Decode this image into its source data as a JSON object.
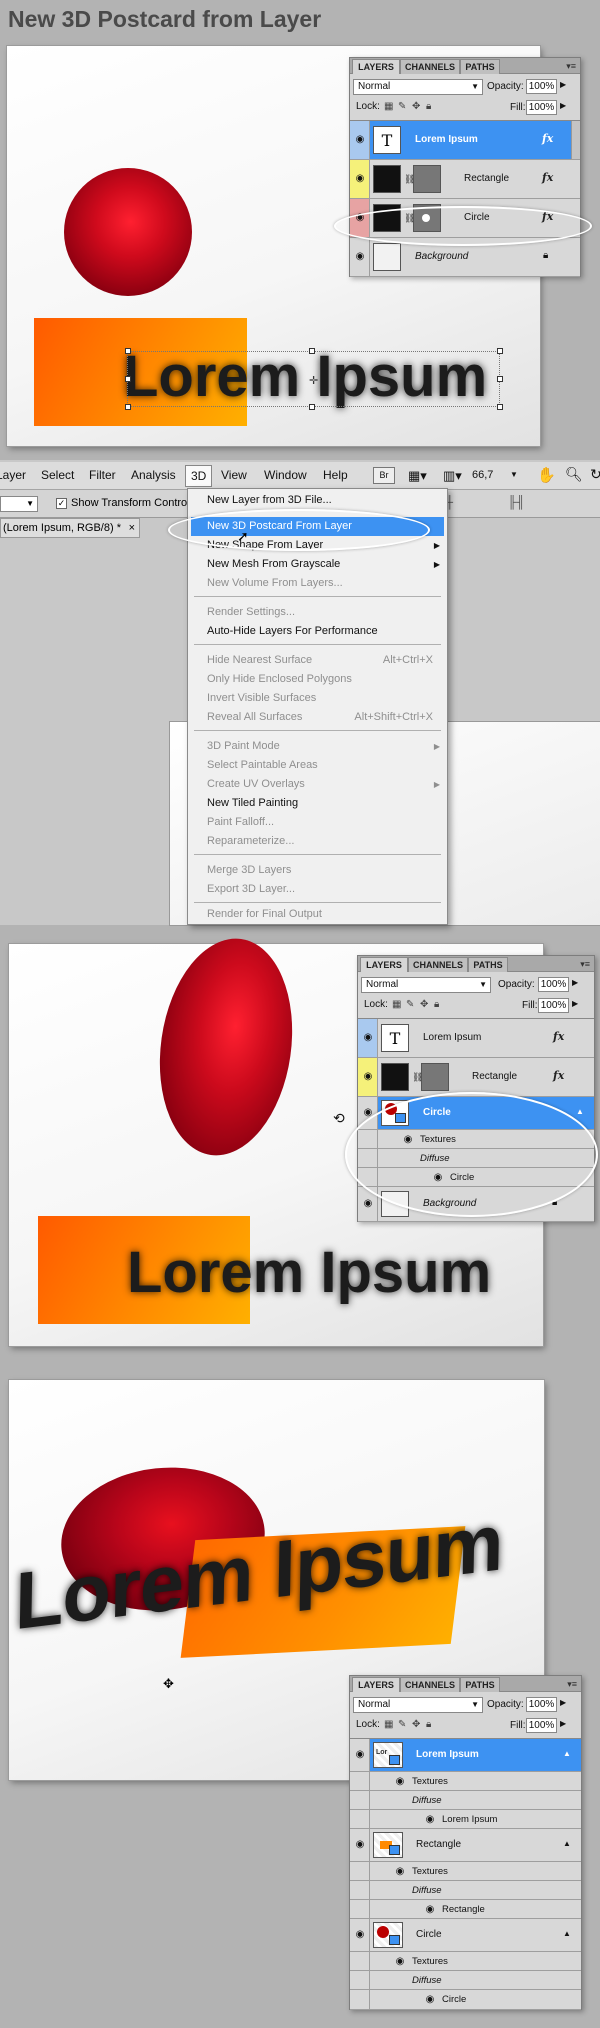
{
  "title": "New 3D Postcard from Layer",
  "canvas_text": "Lorem Ipsum",
  "panels": {
    "tabs": [
      "LAYERS",
      "CHANNELS",
      "PATHS"
    ],
    "blend_mode": "Normal",
    "opacity_label": "Opacity:",
    "opacity": "100%",
    "lock_label": "Lock:",
    "fill_label": "Fill:",
    "fill": "100%",
    "fx": "fx"
  },
  "panel1": {
    "layers": [
      {
        "name": "Lorem Ipsum",
        "thumb": "T"
      },
      {
        "name": "Rectangle"
      },
      {
        "name": "Circle"
      },
      {
        "name": "Background"
      }
    ]
  },
  "menu": {
    "bar": [
      "Layer",
      "Select",
      "Filter",
      "Analysis",
      "3D",
      "View",
      "Window",
      "Help"
    ],
    "zoom": "66,7",
    "show_transform_controls": "Show Transform Controls",
    "doc_tab": "(Lorem Ipsum, RGB/8) *",
    "items": [
      {
        "label": "New Layer from 3D File...",
        "type": "normal"
      },
      {
        "label": "New 3D Postcard From Layer",
        "type": "highlight"
      },
      {
        "label": "New Shape From Layer",
        "type": "normal",
        "submenu": true
      },
      {
        "label": "New Mesh From Grayscale",
        "type": "normal",
        "submenu": true
      },
      {
        "label": "New Volume From Layers...",
        "type": "disabled"
      },
      {
        "label": "Render Settings...",
        "type": "disabled"
      },
      {
        "label": "Auto-Hide Layers For Performance",
        "type": "normal"
      },
      {
        "label": "Hide Nearest Surface",
        "type": "disabled",
        "shortcut": "Alt+Ctrl+X"
      },
      {
        "label": "Only Hide Enclosed Polygons",
        "type": "disabled"
      },
      {
        "label": "Invert Visible Surfaces",
        "type": "disabled"
      },
      {
        "label": "Reveal All Surfaces",
        "type": "disabled",
        "shortcut": "Alt+Shift+Ctrl+X"
      },
      {
        "label": "3D Paint Mode",
        "type": "disabled",
        "submenu": true
      },
      {
        "label": "Select Paintable Areas",
        "type": "disabled"
      },
      {
        "label": "Create UV Overlays",
        "type": "disabled",
        "submenu": true
      },
      {
        "label": "New Tiled Painting",
        "type": "normal"
      },
      {
        "label": "Paint Falloff...",
        "type": "disabled"
      },
      {
        "label": "Reparameterize...",
        "type": "disabled"
      },
      {
        "label": "Merge 3D Layers",
        "type": "disabled"
      },
      {
        "label": "Export 3D Layer...",
        "type": "disabled"
      },
      {
        "label": "Render for Final Output",
        "type": "disabled"
      }
    ]
  },
  "panel3": {
    "layers": [
      {
        "name": "Lorem Ipsum",
        "thumb": "T"
      },
      {
        "name": "Rectangle"
      },
      {
        "name": "Circle"
      },
      {
        "name": "Background"
      }
    ],
    "sub": [
      "Textures",
      "Diffuse",
      "Circle"
    ]
  },
  "panel4": {
    "groups": [
      {
        "name": "Lorem Ipsum",
        "sub": [
          "Textures",
          "Diffuse",
          "Lorem Ipsum"
        ]
      },
      {
        "name": "Rectangle",
        "sub": [
          "Textures",
          "Diffuse",
          "Rectangle"
        ]
      },
      {
        "name": "Circle",
        "sub": [
          "Textures",
          "Diffuse",
          "Circle"
        ]
      }
    ]
  },
  "colors": {
    "selection": "#3d92f2",
    "orange": "#ff8a00",
    "red": "#c8001a"
  }
}
